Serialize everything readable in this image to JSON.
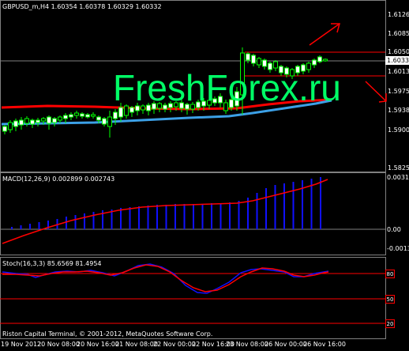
{
  "main": {
    "header": "GBPUSD_m,H4  1.60354 1.60378 1.60329 1.60332",
    "price_labels": [
      "1.61260",
      "1.60850",
      "1.60500",
      "1.60130",
      "1.59750",
      "1.59380",
      "1.59000",
      "1.58250"
    ],
    "current_price": "1.60332",
    "watermark": "FreshForex.ru"
  },
  "macd": {
    "header": "MACD(12,26,9) 0.002899 0.002743",
    "labels": [
      "0.003101",
      "0.00",
      "-0.00134"
    ]
  },
  "stoch": {
    "header": "Stoch(16,3,3) 85.6569 81.4954",
    "labels": [
      "80",
      "50",
      "20"
    ]
  },
  "footer": "Riston Capital Terminal, © 2001-2012, MetaQuotes Software Corp.",
  "x_axis": [
    "19 Nov 2012",
    "20 Nov 08:00",
    "20 Nov 16:00",
    "21 Nov 08:00",
    "22 Nov 00:00",
    "22 Nov 16:00",
    "23 Nov 08:00",
    "26 Nov 00:00",
    "26 Nov 16:00"
  ],
  "colors": {
    "background": "#000000",
    "bull_candle": "#ffffff",
    "bear_candle": "#000000",
    "candle_outline": "#00ff00",
    "ma_red": "#ff0000",
    "ma_blue": "#3ca0e6",
    "watermark": "#00ff66",
    "macd_bars": "#1010ff",
    "macd_signal": "#ff0000",
    "stoch_main": "#1010ff",
    "stoch_signal": "#ff0000",
    "level_lines": "#ff0000",
    "arrows": "#ff0000"
  }
}
